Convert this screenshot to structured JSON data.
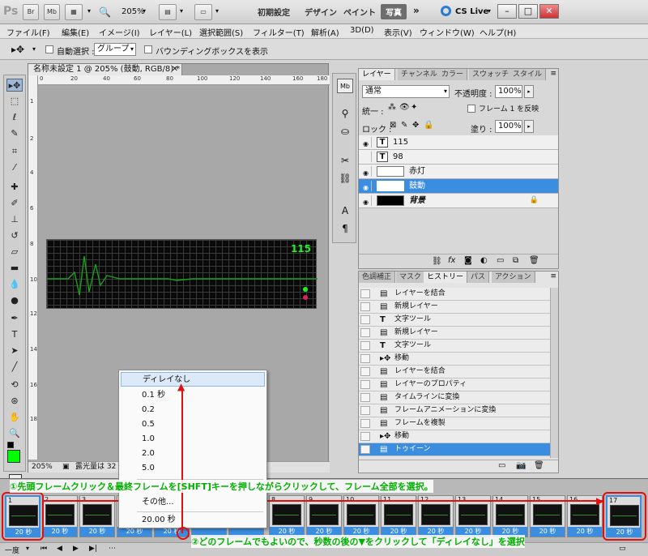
{
  "app": {
    "logo": "Ps",
    "br": "Br",
    "mb": "Mb",
    "zoom": "205%",
    "workspaces": [
      "初期設定",
      "デザイン",
      "ペイント",
      "写真"
    ],
    "cs_live": "CS Live"
  },
  "menu": [
    "ファイル(F)",
    "編集(E)",
    "イメージ(I)",
    "レイヤー(L)",
    "選択範囲(S)",
    "フィルター(T)",
    "解析(A)",
    "3D(D)",
    "表示(V)",
    "ウィンドウ(W)",
    "ヘルプ(H)"
  ],
  "options": {
    "auto_select": "自動選択 :",
    "group": "グループ",
    "bounding_box": "バウンディングボックスを表示"
  },
  "document": {
    "tab_title": "名称未設定 1 @ 205% (鼓動, RGB/8) *",
    "ruler_h": [
      "0",
      "20",
      "40",
      "60",
      "80",
      "100",
      "120",
      "140",
      "160",
      "180"
    ],
    "ruler_v": [
      "1",
      "2",
      "4",
      "6",
      "8",
      "10",
      "12",
      "14",
      "16",
      "18"
    ],
    "canvas_value": "115",
    "status_zoom": "205%",
    "status_text": "露光量は 32"
  },
  "layers_panel": {
    "tabs": [
      "レイヤー",
      "チャンネル",
      "カラー",
      "スウォッチ",
      "スタイル"
    ],
    "blend_mode": "通常",
    "opacity_label": "不透明度 :",
    "opacity_value": "100%",
    "unify_label": "統一 :",
    "propagate_label": "フレーム 1 を反映",
    "lock_label": "ロック :",
    "fill_label": "塗り :",
    "fill_value": "100%",
    "layers": [
      {
        "name": "115",
        "type": "text"
      },
      {
        "name": "98",
        "type": "text"
      },
      {
        "name": "赤灯",
        "type": "image"
      },
      {
        "name": "鼓動",
        "type": "image",
        "selected": true
      },
      {
        "name": "背景",
        "type": "background"
      }
    ]
  },
  "history_panel": {
    "tabs": [
      "色調補正",
      "マスク",
      "ヒストリー",
      "パス",
      "アクション"
    ],
    "items": [
      {
        "label": "レイヤーを結合"
      },
      {
        "label": "新規レイヤー"
      },
      {
        "label": "文字ツール",
        "icon": "T"
      },
      {
        "label": "新規レイヤー"
      },
      {
        "label": "文字ツール",
        "icon": "T"
      },
      {
        "label": "移動",
        "icon": "move"
      },
      {
        "label": "レイヤーを結合"
      },
      {
        "label": "レイヤーのプロパティ"
      },
      {
        "label": "タイムラインに変換"
      },
      {
        "label": "フレームアニメーションに変換"
      },
      {
        "label": "フレームを複製"
      },
      {
        "label": "移動",
        "icon": "move"
      },
      {
        "label": "トゥイーン",
        "selected": true
      }
    ]
  },
  "timeline": {
    "frames": [
      {
        "num": "1",
        "delay": "20 秒"
      },
      {
        "num": "2",
        "delay": "20 秒"
      },
      {
        "num": "3",
        "delay": "20 秒"
      },
      {
        "num": "",
        "delay": "20 秒"
      },
      {
        "num": "",
        "delay": "20 秒"
      },
      {
        "num": "",
        "delay": ""
      },
      {
        "num": "",
        "delay": ""
      },
      {
        "num": "8",
        "delay": "20 秒"
      },
      {
        "num": "9",
        "delay": "20 秒"
      },
      {
        "num": "10",
        "delay": "20 秒"
      },
      {
        "num": "11",
        "delay": "20 秒"
      },
      {
        "num": "12",
        "delay": "20 秒"
      },
      {
        "num": "13",
        "delay": "20 秒"
      },
      {
        "num": "14",
        "delay": "20 秒"
      },
      {
        "num": "15",
        "delay": "20 秒"
      },
      {
        "num": "16",
        "delay": "20 秒"
      },
      {
        "num": "17",
        "delay": "20 秒"
      }
    ],
    "loop": "一度"
  },
  "delay_menu": {
    "items": [
      "ディレイなし",
      "0.1 秒",
      "0.2",
      "0.5",
      "1.0",
      "2.0",
      "5.0",
      "その他...",
      "20.00 秒"
    ]
  },
  "annotations": {
    "step1": "①先頭フレームクリック＆最終フレームを[SHFT]キーを押しながらクリックして、フレーム全部を選択。",
    "step2": "②どのフレームでもよいので、秒数の後の▼をクリックして「ディレイなし」を選択"
  },
  "colors": {
    "accent": "#3b8de0",
    "annotation_red": "#e01010",
    "annotation_green": "#00b000",
    "foreground_swatch": "#00ff00"
  }
}
